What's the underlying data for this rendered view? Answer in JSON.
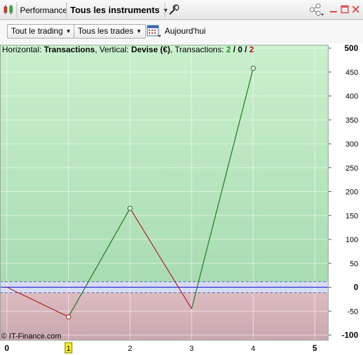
{
  "titlebar": {
    "title": "Performance",
    "instrument_label": "Tous les instruments",
    "icons": [
      "candlestick-chart-icon",
      "wrench-icon",
      "share-icon",
      "minimize-icon",
      "maximize-icon",
      "close-icon"
    ]
  },
  "filters": {
    "period_label": "Tout le trading",
    "trades_label": "Tous les trades",
    "date_label": "Aujourd'hui"
  },
  "info": {
    "horizontal_label": "Horizontal:",
    "horizontal_value": "Transactions",
    "vertical_label": ", Vertical:",
    "vertical_value": "Devise (€)",
    "transactions_label": ", Transactions:",
    "wins": "2",
    "sep1": " / ",
    "neutral": "0",
    "sep2": " / ",
    "losses": "2"
  },
  "copyright": "© IT-Finance.com",
  "colors": {
    "profit_zone": "#b9e9bd",
    "loss_zone": "#d8b9be",
    "up_line": "#1b7a1b",
    "down_line": "#b02020",
    "zero_line": "#2b2bd0",
    "highlight_tick": "#f3f31e"
  },
  "chart_data": {
    "type": "line",
    "x": [
      0,
      1,
      2,
      3,
      4
    ],
    "y": [
      0,
      -62,
      165,
      -45,
      458
    ],
    "markers_at": [
      1,
      2,
      4
    ],
    "xlim": [
      0,
      5
    ],
    "ylim": [
      -100,
      500
    ],
    "x_ticks": [
      "0",
      "1",
      "2",
      "3",
      "4",
      "5"
    ],
    "bold_x_ticks": [
      "0",
      "5"
    ],
    "highlighted_x_tick": "1",
    "y_ticks": [
      "500",
      "450",
      "400",
      "350",
      "300",
      "250",
      "200",
      "150",
      "100",
      "50",
      "0",
      "-50",
      "-100"
    ],
    "bold_y_ticks": [
      "500",
      "0",
      "-100"
    ],
    "grid": true
  }
}
